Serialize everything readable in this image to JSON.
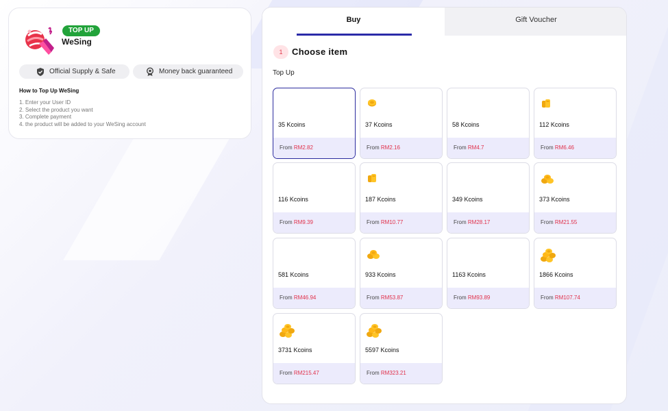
{
  "app": {
    "badge": "TOP UP",
    "name": "WeSing"
  },
  "features": [
    {
      "label": "Official Supply & Safe",
      "icon": "shield-check-icon"
    },
    {
      "label": "Money back guaranteed",
      "icon": "medal-icon"
    }
  ],
  "howto": {
    "title": "How to Top Up WeSing",
    "steps": [
      "1. Enter your User ID",
      "2. Select the product you want",
      "3. Complete payment",
      "4. the product will be added to your WeSing account"
    ]
  },
  "tabs": [
    {
      "label": "Buy",
      "active": true
    },
    {
      "label": "Gift Voucher",
      "active": false
    }
  ],
  "section": {
    "step_number": "1",
    "title": "Choose item",
    "group_label": "Top Up",
    "price_prefix": "From"
  },
  "items": [
    {
      "name": "35 Kcoins",
      "price": "RM2.82",
      "coin": "none",
      "selected": true
    },
    {
      "name": "37 Kcoins",
      "price": "RM2.16",
      "coin": "single"
    },
    {
      "name": "58 Kcoins",
      "price": "RM4.7",
      "coin": "none"
    },
    {
      "name": "112 Kcoins",
      "price": "RM6.46",
      "coin": "stack"
    },
    {
      "name": "116 Kcoins",
      "price": "RM9.39",
      "coin": "none"
    },
    {
      "name": "187 Kcoins",
      "price": "RM10.77",
      "coin": "stack"
    },
    {
      "name": "349 Kcoins",
      "price": "RM28.17",
      "coin": "none"
    },
    {
      "name": "373 Kcoins",
      "price": "RM21.55",
      "coin": "pile"
    },
    {
      "name": "581 Kcoins",
      "price": "RM46.94",
      "coin": "none"
    },
    {
      "name": "933 Kcoins",
      "price": "RM53.87",
      "coin": "pile"
    },
    {
      "name": "1163 Kcoins",
      "price": "RM93.89",
      "coin": "none"
    },
    {
      "name": "1866 Kcoins",
      "price": "RM107.74",
      "coin": "big-pile"
    },
    {
      "name": "3731 Kcoins",
      "price": "RM215.47",
      "coin": "big-pile"
    },
    {
      "name": "5597 Kcoins",
      "price": "RM323.21",
      "coin": "big-pile"
    }
  ],
  "colors": {
    "accent": "#2a2aa8",
    "price": "#e0304a",
    "badge": "#22a33a",
    "price_bar": "#ecebfc"
  }
}
